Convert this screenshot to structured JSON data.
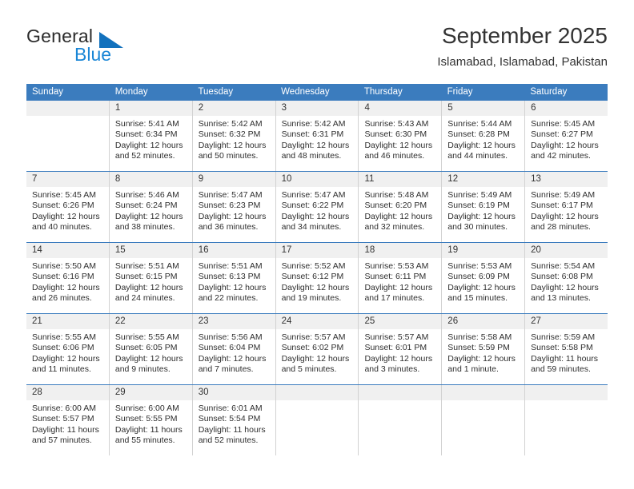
{
  "brand": {
    "word_one": "General",
    "word_two": "Blue",
    "triangle_icon": "triangle-icon",
    "primary_color": "#1271bd",
    "secondary_color": "#1a86d6"
  },
  "header": {
    "month_title": "September 2025",
    "location": "Islamabad, Islamabad, Pakistan"
  },
  "calendar": {
    "header_bg": "#3b7cbe",
    "day_band_bg": "#f0f0f0",
    "weekday_labels": [
      "Sunday",
      "Monday",
      "Tuesday",
      "Wednesday",
      "Thursday",
      "Friday",
      "Saturday"
    ],
    "weeks": [
      [
        {
          "day": "",
          "sunrise": "",
          "sunset": "",
          "daylight_line1": "",
          "daylight_line2": "",
          "blank": true
        },
        {
          "day": "1",
          "sunrise": "Sunrise: 5:41 AM",
          "sunset": "Sunset: 6:34 PM",
          "daylight_line1": "Daylight: 12 hours",
          "daylight_line2": "and 52 minutes."
        },
        {
          "day": "2",
          "sunrise": "Sunrise: 5:42 AM",
          "sunset": "Sunset: 6:32 PM",
          "daylight_line1": "Daylight: 12 hours",
          "daylight_line2": "and 50 minutes."
        },
        {
          "day": "3",
          "sunrise": "Sunrise: 5:42 AM",
          "sunset": "Sunset: 6:31 PM",
          "daylight_line1": "Daylight: 12 hours",
          "daylight_line2": "and 48 minutes."
        },
        {
          "day": "4",
          "sunrise": "Sunrise: 5:43 AM",
          "sunset": "Sunset: 6:30 PM",
          "daylight_line1": "Daylight: 12 hours",
          "daylight_line2": "and 46 minutes."
        },
        {
          "day": "5",
          "sunrise": "Sunrise: 5:44 AM",
          "sunset": "Sunset: 6:28 PM",
          "daylight_line1": "Daylight: 12 hours",
          "daylight_line2": "and 44 minutes."
        },
        {
          "day": "6",
          "sunrise": "Sunrise: 5:45 AM",
          "sunset": "Sunset: 6:27 PM",
          "daylight_line1": "Daylight: 12 hours",
          "daylight_line2": "and 42 minutes."
        }
      ],
      [
        {
          "day": "7",
          "sunrise": "Sunrise: 5:45 AM",
          "sunset": "Sunset: 6:26 PM",
          "daylight_line1": "Daylight: 12 hours",
          "daylight_line2": "and 40 minutes."
        },
        {
          "day": "8",
          "sunrise": "Sunrise: 5:46 AM",
          "sunset": "Sunset: 6:24 PM",
          "daylight_line1": "Daylight: 12 hours",
          "daylight_line2": "and 38 minutes."
        },
        {
          "day": "9",
          "sunrise": "Sunrise: 5:47 AM",
          "sunset": "Sunset: 6:23 PM",
          "daylight_line1": "Daylight: 12 hours",
          "daylight_line2": "and 36 minutes."
        },
        {
          "day": "10",
          "sunrise": "Sunrise: 5:47 AM",
          "sunset": "Sunset: 6:22 PM",
          "daylight_line1": "Daylight: 12 hours",
          "daylight_line2": "and 34 minutes."
        },
        {
          "day": "11",
          "sunrise": "Sunrise: 5:48 AM",
          "sunset": "Sunset: 6:20 PM",
          "daylight_line1": "Daylight: 12 hours",
          "daylight_line2": "and 32 minutes."
        },
        {
          "day": "12",
          "sunrise": "Sunrise: 5:49 AM",
          "sunset": "Sunset: 6:19 PM",
          "daylight_line1": "Daylight: 12 hours",
          "daylight_line2": "and 30 minutes."
        },
        {
          "day": "13",
          "sunrise": "Sunrise: 5:49 AM",
          "sunset": "Sunset: 6:17 PM",
          "daylight_line1": "Daylight: 12 hours",
          "daylight_line2": "and 28 minutes."
        }
      ],
      [
        {
          "day": "14",
          "sunrise": "Sunrise: 5:50 AM",
          "sunset": "Sunset: 6:16 PM",
          "daylight_line1": "Daylight: 12 hours",
          "daylight_line2": "and 26 minutes."
        },
        {
          "day": "15",
          "sunrise": "Sunrise: 5:51 AM",
          "sunset": "Sunset: 6:15 PM",
          "daylight_line1": "Daylight: 12 hours",
          "daylight_line2": "and 24 minutes."
        },
        {
          "day": "16",
          "sunrise": "Sunrise: 5:51 AM",
          "sunset": "Sunset: 6:13 PM",
          "daylight_line1": "Daylight: 12 hours",
          "daylight_line2": "and 22 minutes."
        },
        {
          "day": "17",
          "sunrise": "Sunrise: 5:52 AM",
          "sunset": "Sunset: 6:12 PM",
          "daylight_line1": "Daylight: 12 hours",
          "daylight_line2": "and 19 minutes."
        },
        {
          "day": "18",
          "sunrise": "Sunrise: 5:53 AM",
          "sunset": "Sunset: 6:11 PM",
          "daylight_line1": "Daylight: 12 hours",
          "daylight_line2": "and 17 minutes."
        },
        {
          "day": "19",
          "sunrise": "Sunrise: 5:53 AM",
          "sunset": "Sunset: 6:09 PM",
          "daylight_line1": "Daylight: 12 hours",
          "daylight_line2": "and 15 minutes."
        },
        {
          "day": "20",
          "sunrise": "Sunrise: 5:54 AM",
          "sunset": "Sunset: 6:08 PM",
          "daylight_line1": "Daylight: 12 hours",
          "daylight_line2": "and 13 minutes."
        }
      ],
      [
        {
          "day": "21",
          "sunrise": "Sunrise: 5:55 AM",
          "sunset": "Sunset: 6:06 PM",
          "daylight_line1": "Daylight: 12 hours",
          "daylight_line2": "and 11 minutes."
        },
        {
          "day": "22",
          "sunrise": "Sunrise: 5:55 AM",
          "sunset": "Sunset: 6:05 PM",
          "daylight_line1": "Daylight: 12 hours",
          "daylight_line2": "and 9 minutes."
        },
        {
          "day": "23",
          "sunrise": "Sunrise: 5:56 AM",
          "sunset": "Sunset: 6:04 PM",
          "daylight_line1": "Daylight: 12 hours",
          "daylight_line2": "and 7 minutes."
        },
        {
          "day": "24",
          "sunrise": "Sunrise: 5:57 AM",
          "sunset": "Sunset: 6:02 PM",
          "daylight_line1": "Daylight: 12 hours",
          "daylight_line2": "and 5 minutes."
        },
        {
          "day": "25",
          "sunrise": "Sunrise: 5:57 AM",
          "sunset": "Sunset: 6:01 PM",
          "daylight_line1": "Daylight: 12 hours",
          "daylight_line2": "and 3 minutes."
        },
        {
          "day": "26",
          "sunrise": "Sunrise: 5:58 AM",
          "sunset": "Sunset: 5:59 PM",
          "daylight_line1": "Daylight: 12 hours",
          "daylight_line2": "and 1 minute."
        },
        {
          "day": "27",
          "sunrise": "Sunrise: 5:59 AM",
          "sunset": "Sunset: 5:58 PM",
          "daylight_line1": "Daylight: 11 hours",
          "daylight_line2": "and 59 minutes."
        }
      ],
      [
        {
          "day": "28",
          "sunrise": "Sunrise: 6:00 AM",
          "sunset": "Sunset: 5:57 PM",
          "daylight_line1": "Daylight: 11 hours",
          "daylight_line2": "and 57 minutes."
        },
        {
          "day": "29",
          "sunrise": "Sunrise: 6:00 AM",
          "sunset": "Sunset: 5:55 PM",
          "daylight_line1": "Daylight: 11 hours",
          "daylight_line2": "and 55 minutes."
        },
        {
          "day": "30",
          "sunrise": "Sunrise: 6:01 AM",
          "sunset": "Sunset: 5:54 PM",
          "daylight_line1": "Daylight: 11 hours",
          "daylight_line2": "and 52 minutes."
        },
        {
          "day": "",
          "sunrise": "",
          "sunset": "",
          "daylight_line1": "",
          "daylight_line2": "",
          "blank": true
        },
        {
          "day": "",
          "sunrise": "",
          "sunset": "",
          "daylight_line1": "",
          "daylight_line2": "",
          "blank": true
        },
        {
          "day": "",
          "sunrise": "",
          "sunset": "",
          "daylight_line1": "",
          "daylight_line2": "",
          "blank": true
        },
        {
          "day": "",
          "sunrise": "",
          "sunset": "",
          "daylight_line1": "",
          "daylight_line2": "",
          "blank": true
        }
      ]
    ]
  }
}
